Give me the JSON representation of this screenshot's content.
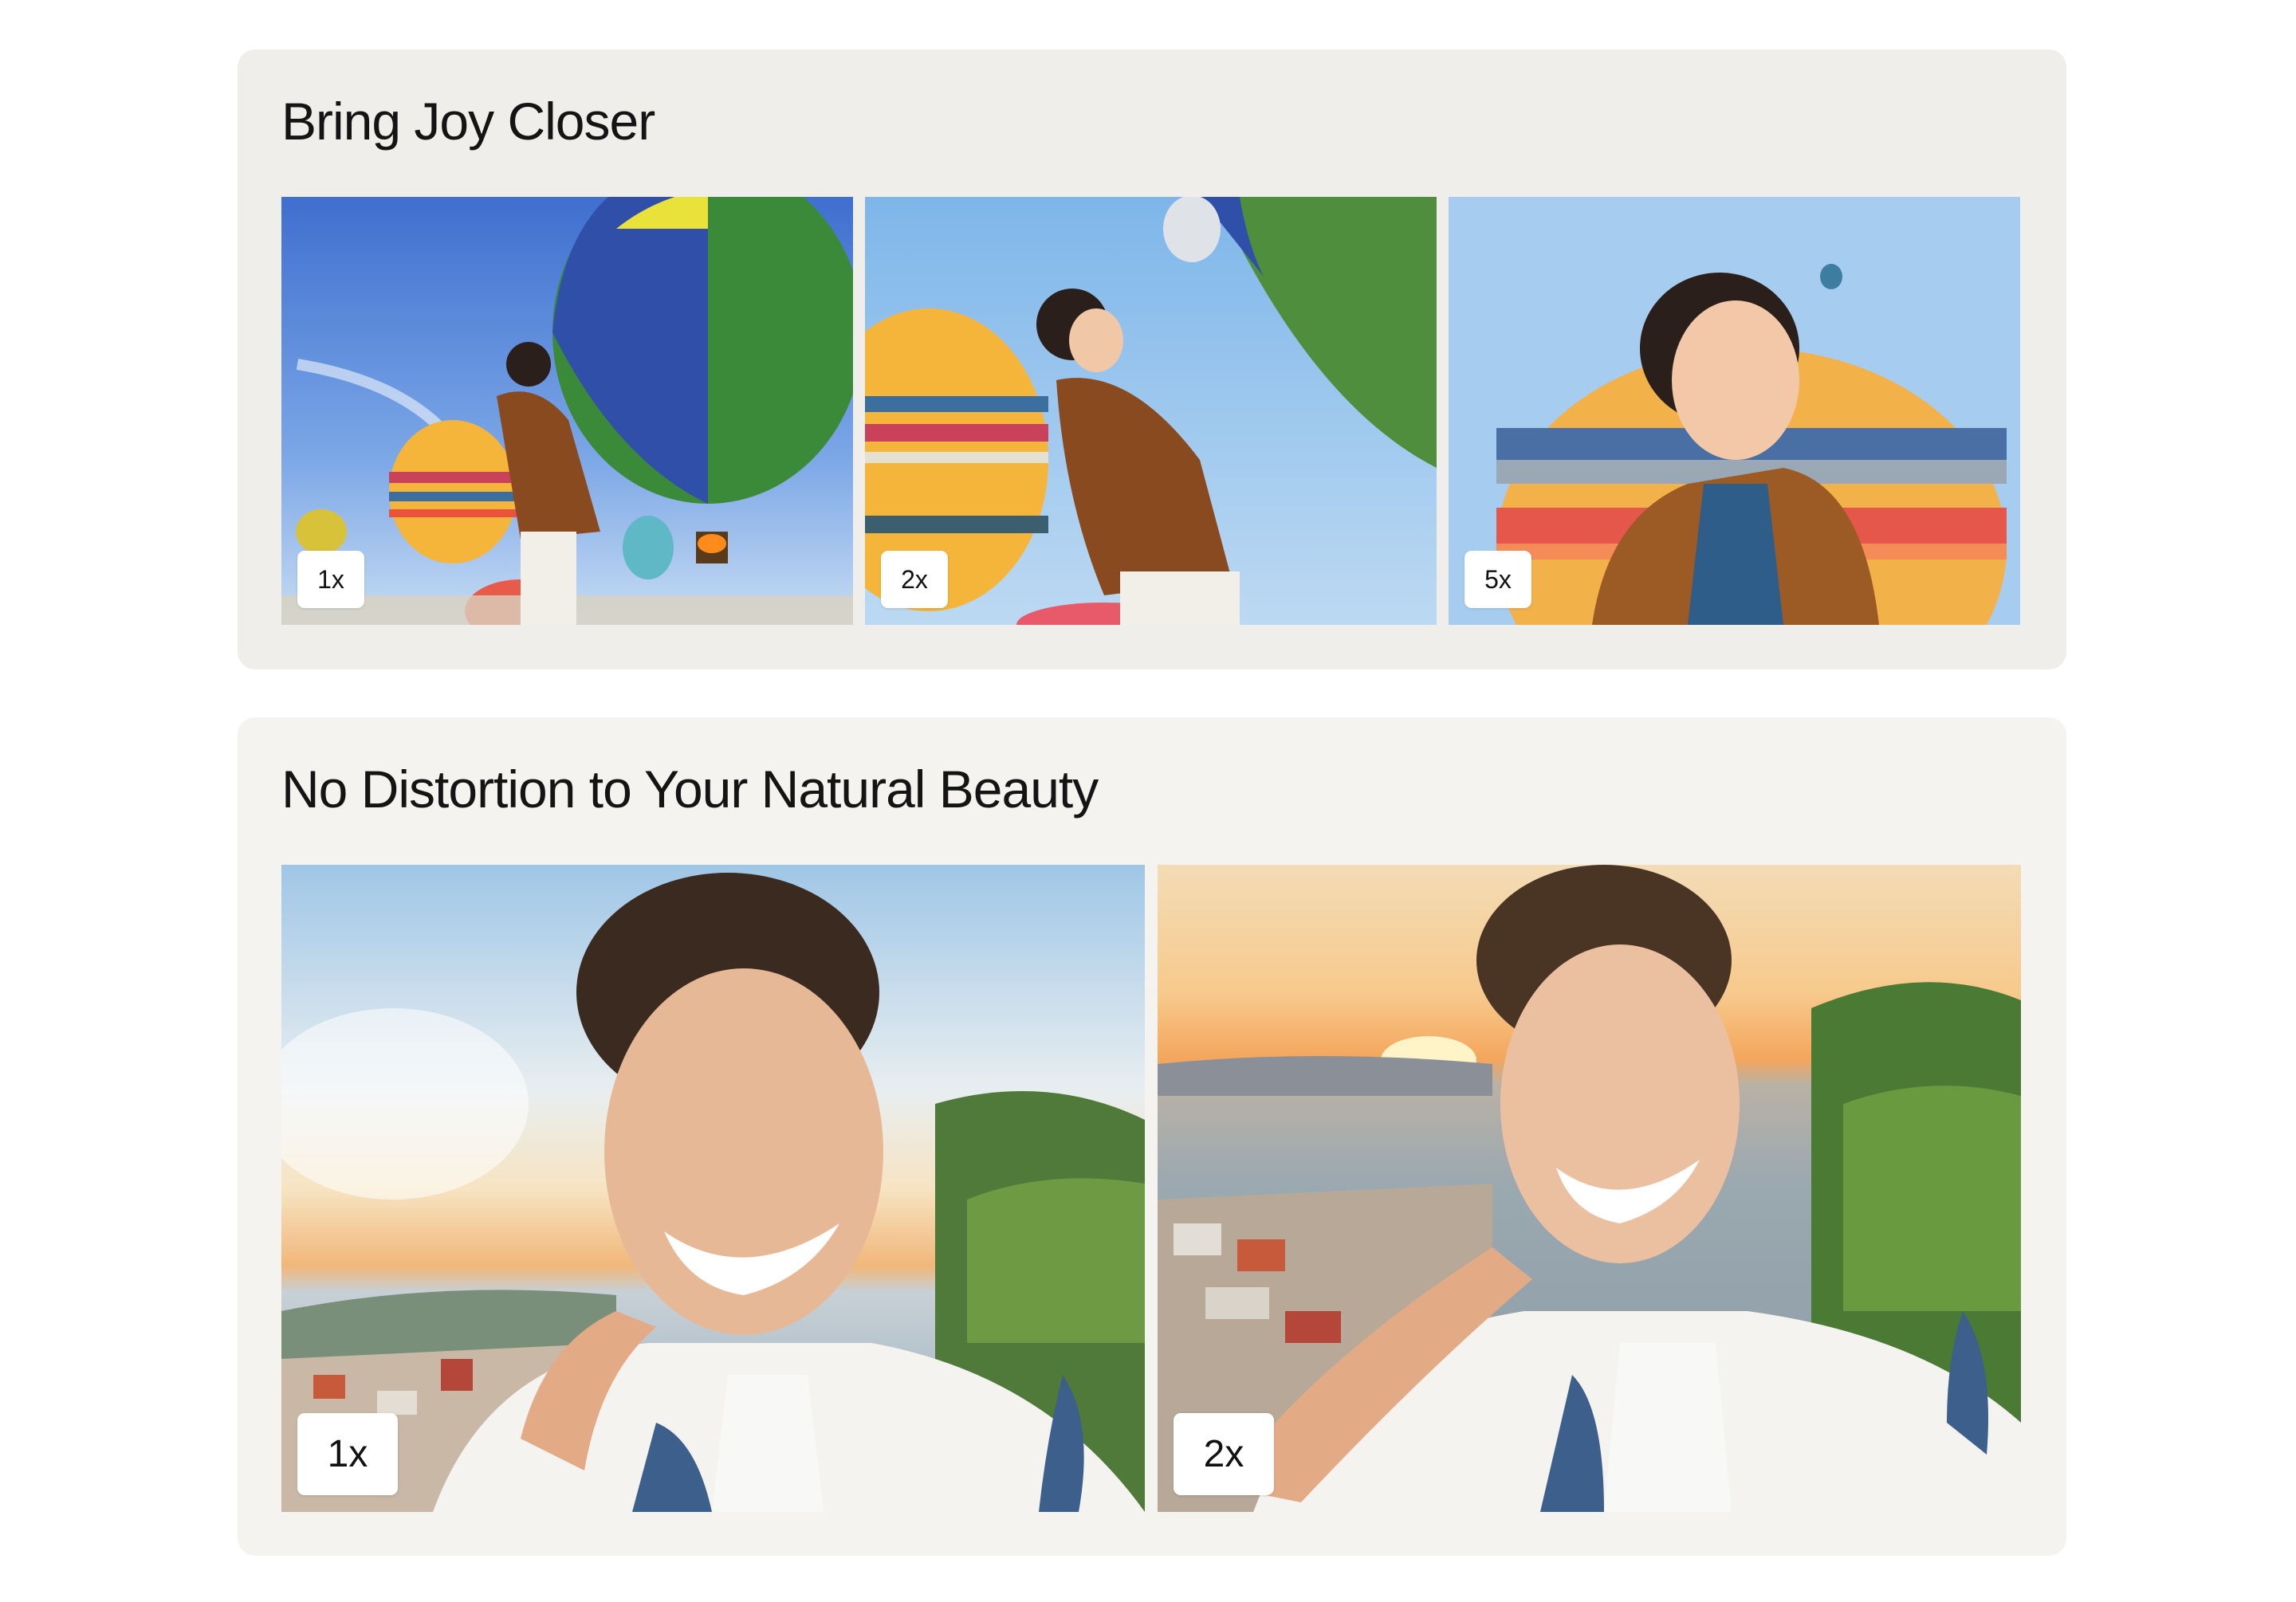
{
  "sections": [
    {
      "title": "Bring Joy Closer",
      "photos": [
        {
          "badge": "1x",
          "scene": "balloon-person-wide"
        },
        {
          "badge": "2x",
          "scene": "balloon-person-medium"
        },
        {
          "badge": "5x",
          "scene": "balloon-person-close"
        }
      ]
    },
    {
      "title": "No Distortion to Your Natural Beauty",
      "photos": [
        {
          "badge": "1x",
          "scene": "sunset-selfie"
        },
        {
          "badge": "2x",
          "scene": "sunset-selfie"
        }
      ]
    }
  ],
  "colors": {
    "card_bg_1": "#efeeeb",
    "card_bg_2": "#f4f3f0",
    "badge_bg": "#ffffff",
    "title_text": "#141414"
  }
}
